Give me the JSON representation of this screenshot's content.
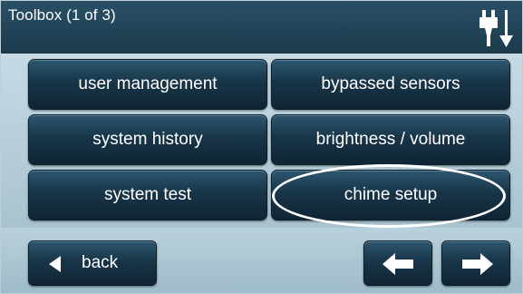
{
  "header": {
    "title": "Toolbox (1 of 3)",
    "icon": "power-plug-down-icon"
  },
  "menu": {
    "items": [
      {
        "label": "user management"
      },
      {
        "label": "bypassed sensors"
      },
      {
        "label": "system history"
      },
      {
        "label": "brightness / volume"
      },
      {
        "label": "system test"
      },
      {
        "label": "chime setup"
      }
    ],
    "highlighted": "chime setup"
  },
  "footer": {
    "back_label": "back",
    "prev_icon": "arrow-left-icon",
    "next_icon": "arrow-right-icon"
  },
  "colors": {
    "header_bg": "#1f4256",
    "button_bg": "#183548",
    "panel_bg": "#b4ccd8",
    "text": "#ffffff"
  }
}
